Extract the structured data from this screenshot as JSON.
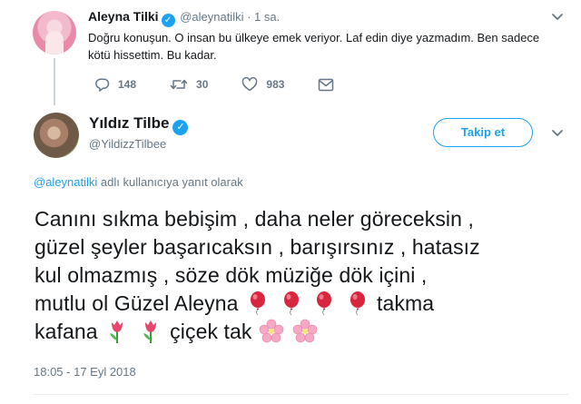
{
  "parent_tweet": {
    "name": "Aleyna Tilki",
    "handle": "@aleynatilki",
    "time": "· 1 sa.",
    "text": "Doğru konuşun. O insan bu ülkeye emek veriyor. Laf edin diye yazmadım. Ben sadece kötü hissettim. Bu kadar.",
    "reply_count": "148",
    "retweet_count": "30",
    "like_count": "983"
  },
  "main_tweet": {
    "name": "Yıldız Tilbe",
    "handle": "@YildizzTilbee",
    "follow_label": "Takip et",
    "reply_mention": "@aleynatilki",
    "reply_suffix": " adlı kullanıcıya yanıt olarak",
    "text_line1": "Canını sıkma bebişim , daha neler göreceksin ,",
    "text_line2": "güzel şeyler başarıcaksın , barışırsınız , hatasız",
    "text_line3": "kul olmazmış , söze dök müziğe dök içini ,",
    "text_line4a": "mutlu ol Güzel Aleyna ",
    "text_line4b": "takma",
    "text_line5a": "kafana ",
    "text_line5b": "çiçek tak ",
    "timestamp": "18:05 - 17 Eyl 2018"
  },
  "icons": {
    "verified": "verified-badge-icon",
    "reply": "reply-icon",
    "retweet": "retweet-icon",
    "like": "heart-icon",
    "message": "envelope-icon",
    "balloon": "balloon-emoji",
    "tulip": "tulip-emoji",
    "flower": "cherry-blossom-emoji"
  },
  "colors": {
    "accent": "#1da1f2",
    "secondary_text": "#657786"
  }
}
